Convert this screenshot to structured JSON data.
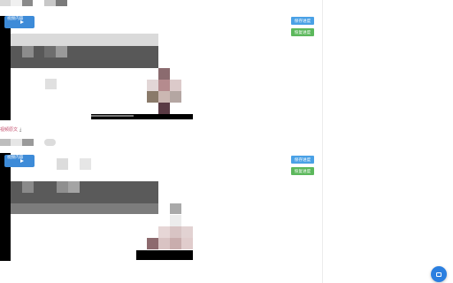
{
  "posts": [
    {
      "badge_label": "视频内容",
      "save_label": "保存进度",
      "restore_label": "恢复进度"
    },
    {
      "badge_label": "视频内容",
      "save_label": "保存进度",
      "restore_label": "恢复进度"
    }
  ],
  "source_link_label": "视频原文",
  "download_icon": "download-icon",
  "fab_icon": "chat-icon",
  "colors": {
    "accent_blue": "#4aa1e6",
    "restore_green": "#5cb85c",
    "source_link": "#c24b6a",
    "fab_blue": "#2b7fe0"
  }
}
